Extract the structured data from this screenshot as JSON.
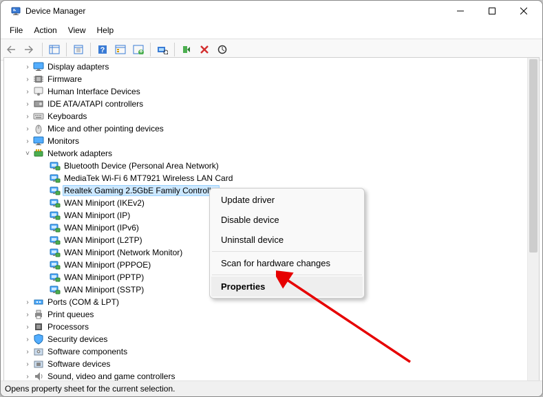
{
  "window": {
    "title": "Device Manager"
  },
  "menu": {
    "file": "File",
    "action": "Action",
    "view": "View",
    "help": "Help"
  },
  "status": "Opens property sheet for the current selection.",
  "categories": [
    {
      "label": "Display adapters",
      "expanded": false,
      "icon": "monitor"
    },
    {
      "label": "Firmware",
      "expanded": false,
      "icon": "chip"
    },
    {
      "label": "Human Interface Devices",
      "expanded": false,
      "icon": "hid"
    },
    {
      "label": "IDE ATA/ATAPI controllers",
      "expanded": false,
      "icon": "storage-ctrl"
    },
    {
      "label": "Keyboards",
      "expanded": false,
      "icon": "keyboard"
    },
    {
      "label": "Mice and other pointing devices",
      "expanded": false,
      "icon": "mouse"
    },
    {
      "label": "Monitors",
      "expanded": false,
      "icon": "monitor"
    },
    {
      "label": "Network adapters",
      "expanded": true,
      "icon": "network",
      "devices": [
        {
          "label": "Bluetooth Device (Personal Area Network)"
        },
        {
          "label": "MediaTek Wi-Fi 6 MT7921 Wireless LAN Card"
        },
        {
          "label": "Realtek Gaming 2.5GbE Family Controller",
          "selected": true
        },
        {
          "label": "WAN Miniport (IKEv2)"
        },
        {
          "label": "WAN Miniport (IP)"
        },
        {
          "label": "WAN Miniport (IPv6)"
        },
        {
          "label": "WAN Miniport (L2TP)"
        },
        {
          "label": "WAN Miniport (Network Monitor)"
        },
        {
          "label": "WAN Miniport (PPPOE)"
        },
        {
          "label": "WAN Miniport (PPTP)"
        },
        {
          "label": "WAN Miniport (SSTP)"
        }
      ]
    },
    {
      "label": "Ports (COM & LPT)",
      "expanded": false,
      "icon": "port"
    },
    {
      "label": "Print queues",
      "expanded": false,
      "icon": "printer"
    },
    {
      "label": "Processors",
      "expanded": false,
      "icon": "cpu"
    },
    {
      "label": "Security devices",
      "expanded": false,
      "icon": "security"
    },
    {
      "label": "Software components",
      "expanded": false,
      "icon": "swcomp"
    },
    {
      "label": "Software devices",
      "expanded": false,
      "icon": "swdev"
    },
    {
      "label": "Sound, video and game controllers",
      "expanded": false,
      "icon": "sound"
    }
  ],
  "context_menu": {
    "items": [
      {
        "label": "Update driver"
      },
      {
        "label": "Disable device"
      },
      {
        "label": "Uninstall device"
      }
    ],
    "items2": [
      {
        "label": "Scan for hardware changes"
      }
    ],
    "items3": [
      {
        "label": "Properties",
        "hover": true
      }
    ]
  }
}
